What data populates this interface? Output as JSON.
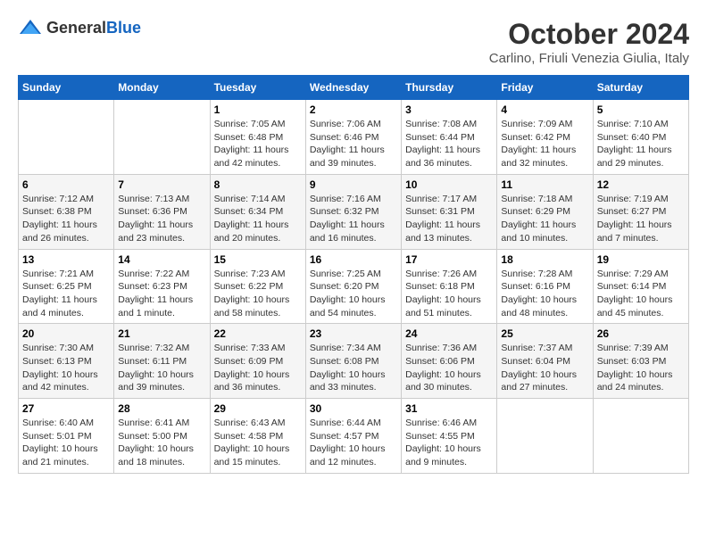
{
  "header": {
    "logo_general": "General",
    "logo_blue": "Blue",
    "month_title": "October 2024",
    "location": "Carlino, Friuli Venezia Giulia, Italy"
  },
  "weekdays": [
    "Sunday",
    "Monday",
    "Tuesday",
    "Wednesday",
    "Thursday",
    "Friday",
    "Saturday"
  ],
  "weeks": [
    [
      {
        "day": "",
        "info": ""
      },
      {
        "day": "",
        "info": ""
      },
      {
        "day": "1",
        "info": "Sunrise: 7:05 AM\nSunset: 6:48 PM\nDaylight: 11 hours and 42 minutes."
      },
      {
        "day": "2",
        "info": "Sunrise: 7:06 AM\nSunset: 6:46 PM\nDaylight: 11 hours and 39 minutes."
      },
      {
        "day": "3",
        "info": "Sunrise: 7:08 AM\nSunset: 6:44 PM\nDaylight: 11 hours and 36 minutes."
      },
      {
        "day": "4",
        "info": "Sunrise: 7:09 AM\nSunset: 6:42 PM\nDaylight: 11 hours and 32 minutes."
      },
      {
        "day": "5",
        "info": "Sunrise: 7:10 AM\nSunset: 6:40 PM\nDaylight: 11 hours and 29 minutes."
      }
    ],
    [
      {
        "day": "6",
        "info": "Sunrise: 7:12 AM\nSunset: 6:38 PM\nDaylight: 11 hours and 26 minutes."
      },
      {
        "day": "7",
        "info": "Sunrise: 7:13 AM\nSunset: 6:36 PM\nDaylight: 11 hours and 23 minutes."
      },
      {
        "day": "8",
        "info": "Sunrise: 7:14 AM\nSunset: 6:34 PM\nDaylight: 11 hours and 20 minutes."
      },
      {
        "day": "9",
        "info": "Sunrise: 7:16 AM\nSunset: 6:32 PM\nDaylight: 11 hours and 16 minutes."
      },
      {
        "day": "10",
        "info": "Sunrise: 7:17 AM\nSunset: 6:31 PM\nDaylight: 11 hours and 13 minutes."
      },
      {
        "day": "11",
        "info": "Sunrise: 7:18 AM\nSunset: 6:29 PM\nDaylight: 11 hours and 10 minutes."
      },
      {
        "day": "12",
        "info": "Sunrise: 7:19 AM\nSunset: 6:27 PM\nDaylight: 11 hours and 7 minutes."
      }
    ],
    [
      {
        "day": "13",
        "info": "Sunrise: 7:21 AM\nSunset: 6:25 PM\nDaylight: 11 hours and 4 minutes."
      },
      {
        "day": "14",
        "info": "Sunrise: 7:22 AM\nSunset: 6:23 PM\nDaylight: 11 hours and 1 minute."
      },
      {
        "day": "15",
        "info": "Sunrise: 7:23 AM\nSunset: 6:22 PM\nDaylight: 10 hours and 58 minutes."
      },
      {
        "day": "16",
        "info": "Sunrise: 7:25 AM\nSunset: 6:20 PM\nDaylight: 10 hours and 54 minutes."
      },
      {
        "day": "17",
        "info": "Sunrise: 7:26 AM\nSunset: 6:18 PM\nDaylight: 10 hours and 51 minutes."
      },
      {
        "day": "18",
        "info": "Sunrise: 7:28 AM\nSunset: 6:16 PM\nDaylight: 10 hours and 48 minutes."
      },
      {
        "day": "19",
        "info": "Sunrise: 7:29 AM\nSunset: 6:14 PM\nDaylight: 10 hours and 45 minutes."
      }
    ],
    [
      {
        "day": "20",
        "info": "Sunrise: 7:30 AM\nSunset: 6:13 PM\nDaylight: 10 hours and 42 minutes."
      },
      {
        "day": "21",
        "info": "Sunrise: 7:32 AM\nSunset: 6:11 PM\nDaylight: 10 hours and 39 minutes."
      },
      {
        "day": "22",
        "info": "Sunrise: 7:33 AM\nSunset: 6:09 PM\nDaylight: 10 hours and 36 minutes."
      },
      {
        "day": "23",
        "info": "Sunrise: 7:34 AM\nSunset: 6:08 PM\nDaylight: 10 hours and 33 minutes."
      },
      {
        "day": "24",
        "info": "Sunrise: 7:36 AM\nSunset: 6:06 PM\nDaylight: 10 hours and 30 minutes."
      },
      {
        "day": "25",
        "info": "Sunrise: 7:37 AM\nSunset: 6:04 PM\nDaylight: 10 hours and 27 minutes."
      },
      {
        "day": "26",
        "info": "Sunrise: 7:39 AM\nSunset: 6:03 PM\nDaylight: 10 hours and 24 minutes."
      }
    ],
    [
      {
        "day": "27",
        "info": "Sunrise: 6:40 AM\nSunset: 5:01 PM\nDaylight: 10 hours and 21 minutes."
      },
      {
        "day": "28",
        "info": "Sunrise: 6:41 AM\nSunset: 5:00 PM\nDaylight: 10 hours and 18 minutes."
      },
      {
        "day": "29",
        "info": "Sunrise: 6:43 AM\nSunset: 4:58 PM\nDaylight: 10 hours and 15 minutes."
      },
      {
        "day": "30",
        "info": "Sunrise: 6:44 AM\nSunset: 4:57 PM\nDaylight: 10 hours and 12 minutes."
      },
      {
        "day": "31",
        "info": "Sunrise: 6:46 AM\nSunset: 4:55 PM\nDaylight: 10 hours and 9 minutes."
      },
      {
        "day": "",
        "info": ""
      },
      {
        "day": "",
        "info": ""
      }
    ]
  ]
}
